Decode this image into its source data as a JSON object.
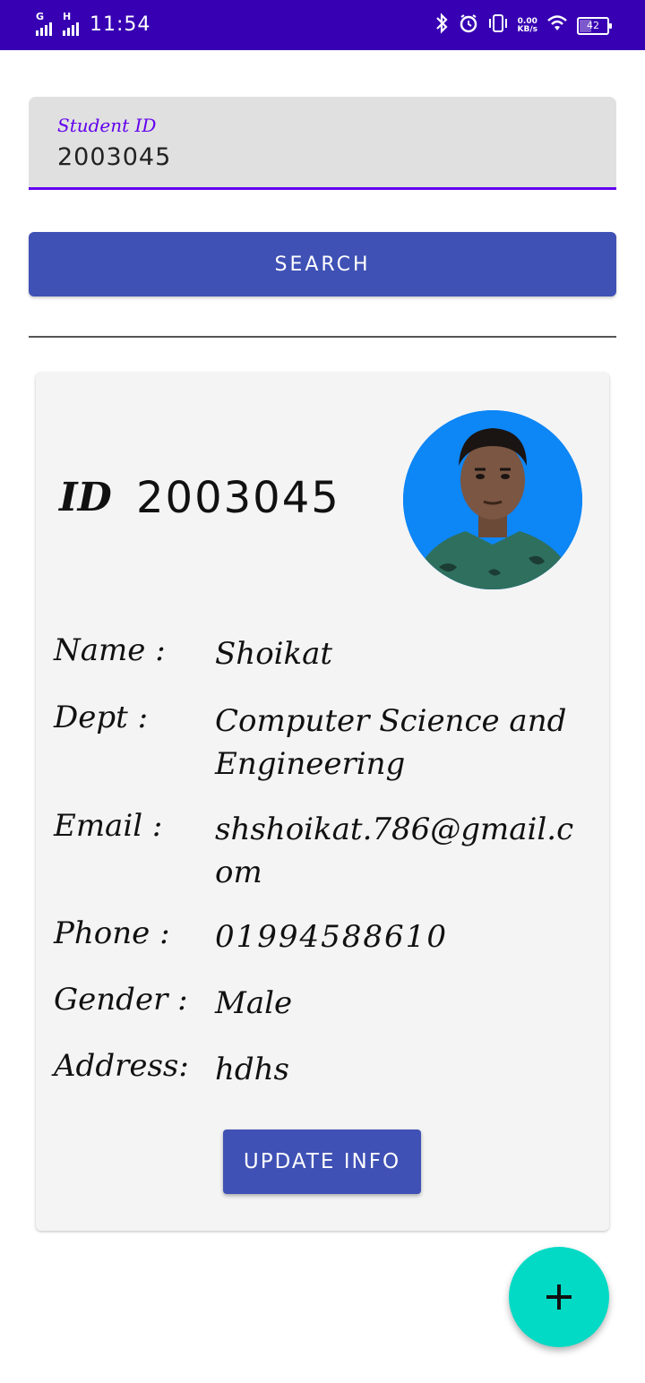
{
  "status_bar": {
    "sim1": "G",
    "sim2": "H",
    "time": "11:54",
    "net_speed_value": "0.00",
    "net_speed_unit": "KB/s",
    "battery": "42",
    "battery_level": 0.42,
    "bar_color": "#3700b3"
  },
  "search": {
    "label": "Student ID",
    "value": "2003045",
    "button": "SEARCH",
    "accent": "#6200ee",
    "button_color": "#3f51b5"
  },
  "card": {
    "id_label": "ID",
    "id_value": "2003045",
    "fields": [
      {
        "key": "Name :",
        "value": "Shoikat"
      },
      {
        "key": "Dept :",
        "value": "Computer Science and Engineering"
      },
      {
        "key": "Email :",
        "value": "shshoikat.786@gmail.com"
      },
      {
        "key": "Phone :",
        "value": "01994588610"
      },
      {
        "key": "Gender :",
        "value": "Male"
      },
      {
        "key": "Address:",
        "value": "hdhs"
      }
    ],
    "update_button": "UPDATE INFO"
  },
  "fab": {
    "icon": "plus-icon",
    "color": "#03dac5"
  }
}
